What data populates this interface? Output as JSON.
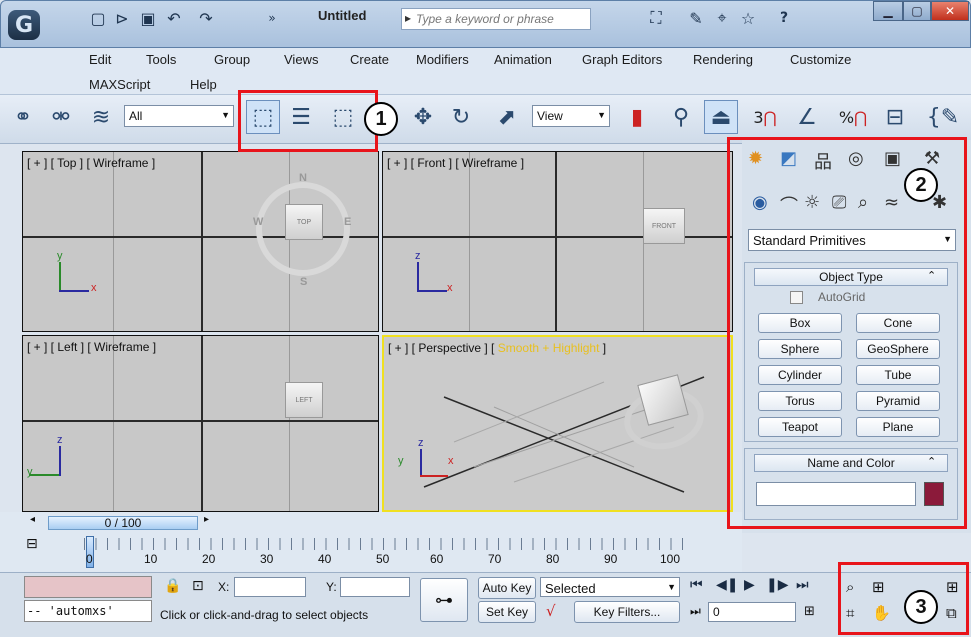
{
  "title_bar": {
    "logo": "3ds-max-logo",
    "window_title": "Untitled",
    "search_placeholder": "Type a keyword or phrase",
    "help_label": "?"
  },
  "menu": {
    "row1": [
      "Edit",
      "Tools",
      "Group",
      "Views",
      "Create",
      "Modifiers",
      "Animation",
      "Graph Editors",
      "Rendering",
      "Customize"
    ],
    "row2": [
      "MAXScript",
      "Help"
    ]
  },
  "toolbar": {
    "selection_filter": "All",
    "ref_coord_system": "View",
    "snap_labels": [
      "3",
      "%"
    ]
  },
  "viewports": {
    "top": {
      "label": "[ + ] [ Top ] [ Wireframe ]",
      "cube": "TOP",
      "compass": {
        "n": "N",
        "s": "S",
        "e": "E",
        "w": "W"
      },
      "axes": {
        "v": "y",
        "h": "x"
      }
    },
    "front": {
      "label": "[ + ] [ Front ] [ Wireframe ]",
      "cube": "FRONT",
      "axes": {
        "v": "z",
        "h": "x"
      }
    },
    "left": {
      "label": "[ + ] [ Left ] [ Wireframe ]",
      "cube": "LEFT",
      "axes": {
        "v": "z",
        "h": "y"
      }
    },
    "perspective": {
      "label_prefix": "[ + ] [ Perspective ] [ ",
      "label_mode": "Smooth + Highlight",
      "label_suffix": " ]",
      "axes": {
        "v": "z",
        "h": "x",
        "d": "y"
      }
    }
  },
  "command_panel": {
    "category_dropdown": "Standard Primitives",
    "object_type_title": "Object Type",
    "autogrid_label": "AutoGrid",
    "primitives": [
      "Box",
      "Cone",
      "Sphere",
      "GeoSphere",
      "Cylinder",
      "Tube",
      "Torus",
      "Pyramid",
      "Teapot",
      "Plane"
    ],
    "name_color_title": "Name and Color",
    "object_name": "",
    "object_color": "#8b1a3a"
  },
  "timeline": {
    "slider_text": "0 / 100",
    "ticks": [
      "0",
      "10",
      "20",
      "30",
      "40",
      "50",
      "60",
      "70",
      "80",
      "90",
      "100"
    ]
  },
  "status": {
    "maxscript_listener": "-- 'automxs'",
    "prompt": "Click or click-and-drag to select objects",
    "x_label": "X:",
    "y_label": "Y:",
    "auto_key": "Auto Key",
    "set_key": "Set Key",
    "key_mode": "Selected",
    "key_filters": "Key Filters...",
    "frame": "0"
  },
  "callouts": [
    "1",
    "2",
    "3"
  ],
  "colors": {
    "callout_border": "#e8141b",
    "active_viewport_border": "#f0e020",
    "shading_label": "#e8c020"
  }
}
